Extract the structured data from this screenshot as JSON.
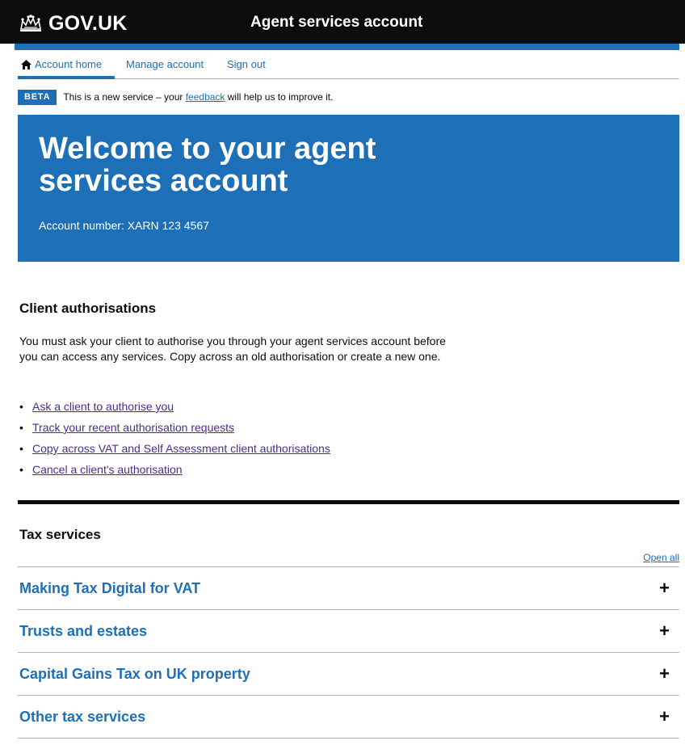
{
  "header": {
    "logo_text": "GOV.UK",
    "service_name": "Agent services account"
  },
  "nav": {
    "items": [
      {
        "label": "Account home",
        "icon": "home-icon",
        "active": true
      },
      {
        "label": "Manage account"
      },
      {
        "label": "Sign out"
      }
    ]
  },
  "beta": {
    "tag": "BETA",
    "text_before": "This is a new service – your ",
    "link": "feedback",
    "text_after": " will help us to improve it."
  },
  "banner": {
    "title": "Welcome to your agent services account",
    "account_number": "Account number: XARN 123 4567"
  },
  "client_authorisations": {
    "heading": "Client authorisations",
    "description": "You must ask your client to authorise you through your agent services account before you can access any services. Copy across an old authorisation or create a new one.",
    "links": [
      "Ask a client to authorise you",
      "Track your recent authorisation requests",
      "Copy across VAT and Self Assessment client authorisations",
      "Cancel a client's authorisation"
    ]
  },
  "tax_services": {
    "heading": "Tax services",
    "open_all": "Open all",
    "sections": [
      {
        "title": "Making Tax Digital for VAT",
        "icon": "+"
      },
      {
        "title": "Trusts and estates",
        "icon": "+"
      },
      {
        "title": "Capital Gains Tax on UK property",
        "icon": "+"
      },
      {
        "title": "Other tax services",
        "icon": "+"
      }
    ]
  },
  "colors": {
    "brand_blue": "#1d70b8",
    "black": "#0b0c0c",
    "visited_link": "#4c2c92",
    "border_grey": "#b1b4b6"
  }
}
